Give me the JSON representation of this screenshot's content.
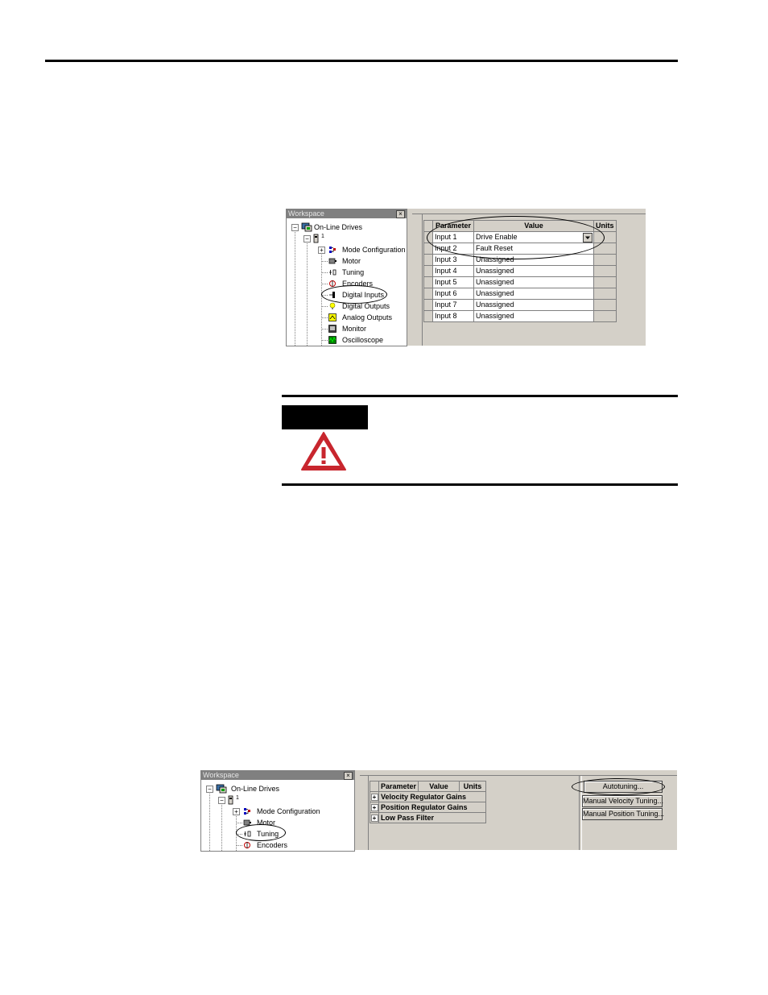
{
  "figure1": {
    "workspace_title": "Workspace",
    "close_glyph": "×",
    "tree": {
      "root": "On-Line Drives",
      "drive": "1",
      "items": [
        "Mode Configuration",
        "Motor",
        "Tuning",
        "Encoders",
        "Digital Inputs",
        "Digital Outputs",
        "Analog Outputs",
        "Monitor",
        "Oscilloscope"
      ]
    },
    "grid": {
      "headers": [
        "Parameter",
        "Value",
        "Units"
      ],
      "rows": [
        {
          "parameter": "Input 1",
          "value": "Drive Enable"
        },
        {
          "parameter": "Input 2",
          "value": "Fault Reset"
        },
        {
          "parameter": "Input 3",
          "value": "Unassigned"
        },
        {
          "parameter": "Input 4",
          "value": "Unassigned"
        },
        {
          "parameter": "Input 5",
          "value": "Unassigned"
        },
        {
          "parameter": "Input 6",
          "value": "Unassigned"
        },
        {
          "parameter": "Input 7",
          "value": "Unassigned"
        },
        {
          "parameter": "Input 8",
          "value": "Unassigned"
        }
      ]
    }
  },
  "warning": {
    "icon": "warning-triangle-icon",
    "icon_color": "#c8262e"
  },
  "figure2": {
    "workspace_title": "Workspace",
    "close_glyph": "×",
    "tree": {
      "root": "On-Line Drives",
      "drive": "1",
      "items": [
        "Mode Configuration",
        "Motor",
        "Tuning",
        "Encoders"
      ]
    },
    "grid": {
      "headers": [
        "Parameter",
        "Value",
        "Units"
      ],
      "groups": [
        "Velocity Regulator Gains",
        "Position Regulator Gains",
        "Low Pass Filter"
      ]
    },
    "buttons": [
      "Autotuning...",
      "Manual Velocity Tuning...",
      "Manual Position Tuning..."
    ]
  }
}
